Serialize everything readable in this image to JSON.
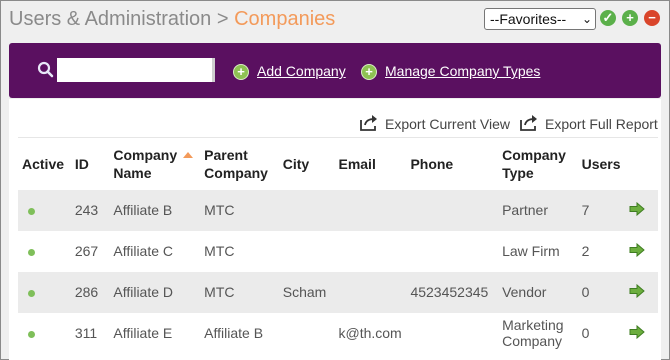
{
  "header": {
    "breadcrumb_parent": "Users & Administration",
    "breadcrumb_sep": " > ",
    "breadcrumb_current": "Companies",
    "favorites_selected": "--Favorites--",
    "add_icon_glyph": "+",
    "remove_icon_glyph": "−",
    "check_icon_glyph": "✓"
  },
  "toolbar": {
    "search_value": "",
    "add_company_label": "Add Company",
    "manage_types_label": "Manage Company Types",
    "background": "#5a1060"
  },
  "exports": {
    "current_view_label": "Export Current View",
    "full_report_label": "Export Full Report"
  },
  "table": {
    "columns": {
      "active": "Active",
      "id": "ID",
      "company_name_1": "Company",
      "company_name_2": "Name",
      "parent_1": "Parent",
      "parent_2": "Company",
      "city": "City",
      "email": "Email",
      "phone": "Phone",
      "type_1": "Company",
      "type_2": "Type",
      "users": "Users"
    },
    "rows": [
      {
        "id": "243",
        "name": "Affiliate B",
        "parent": "MTC",
        "city": "",
        "email": "",
        "phone": "",
        "type": "Partner",
        "type_2": "",
        "users": "7"
      },
      {
        "id": "267",
        "name": "Affiliate C",
        "parent": "MTC",
        "city": "",
        "email": "",
        "phone": "",
        "type": "Law Firm",
        "type_2": "",
        "users": "2"
      },
      {
        "id": "286",
        "name": "Affiliate D",
        "parent": "MTC",
        "city": "Scham",
        "email": "",
        "phone": "4523452345",
        "type": "Vendor",
        "type_2": "",
        "users": "0"
      },
      {
        "id": "311",
        "name": "Affiliate E",
        "parent": "Affiliate B",
        "city": "",
        "email": "k@th.com",
        "phone": "",
        "type": "Marketing",
        "type_2": "Company",
        "users": "0"
      }
    ]
  },
  "colors": {
    "accent_orange": "#f39a5a",
    "active_green": "#7fbf5a",
    "add_green": "#5bb04a",
    "remove_red": "#d9452b"
  }
}
